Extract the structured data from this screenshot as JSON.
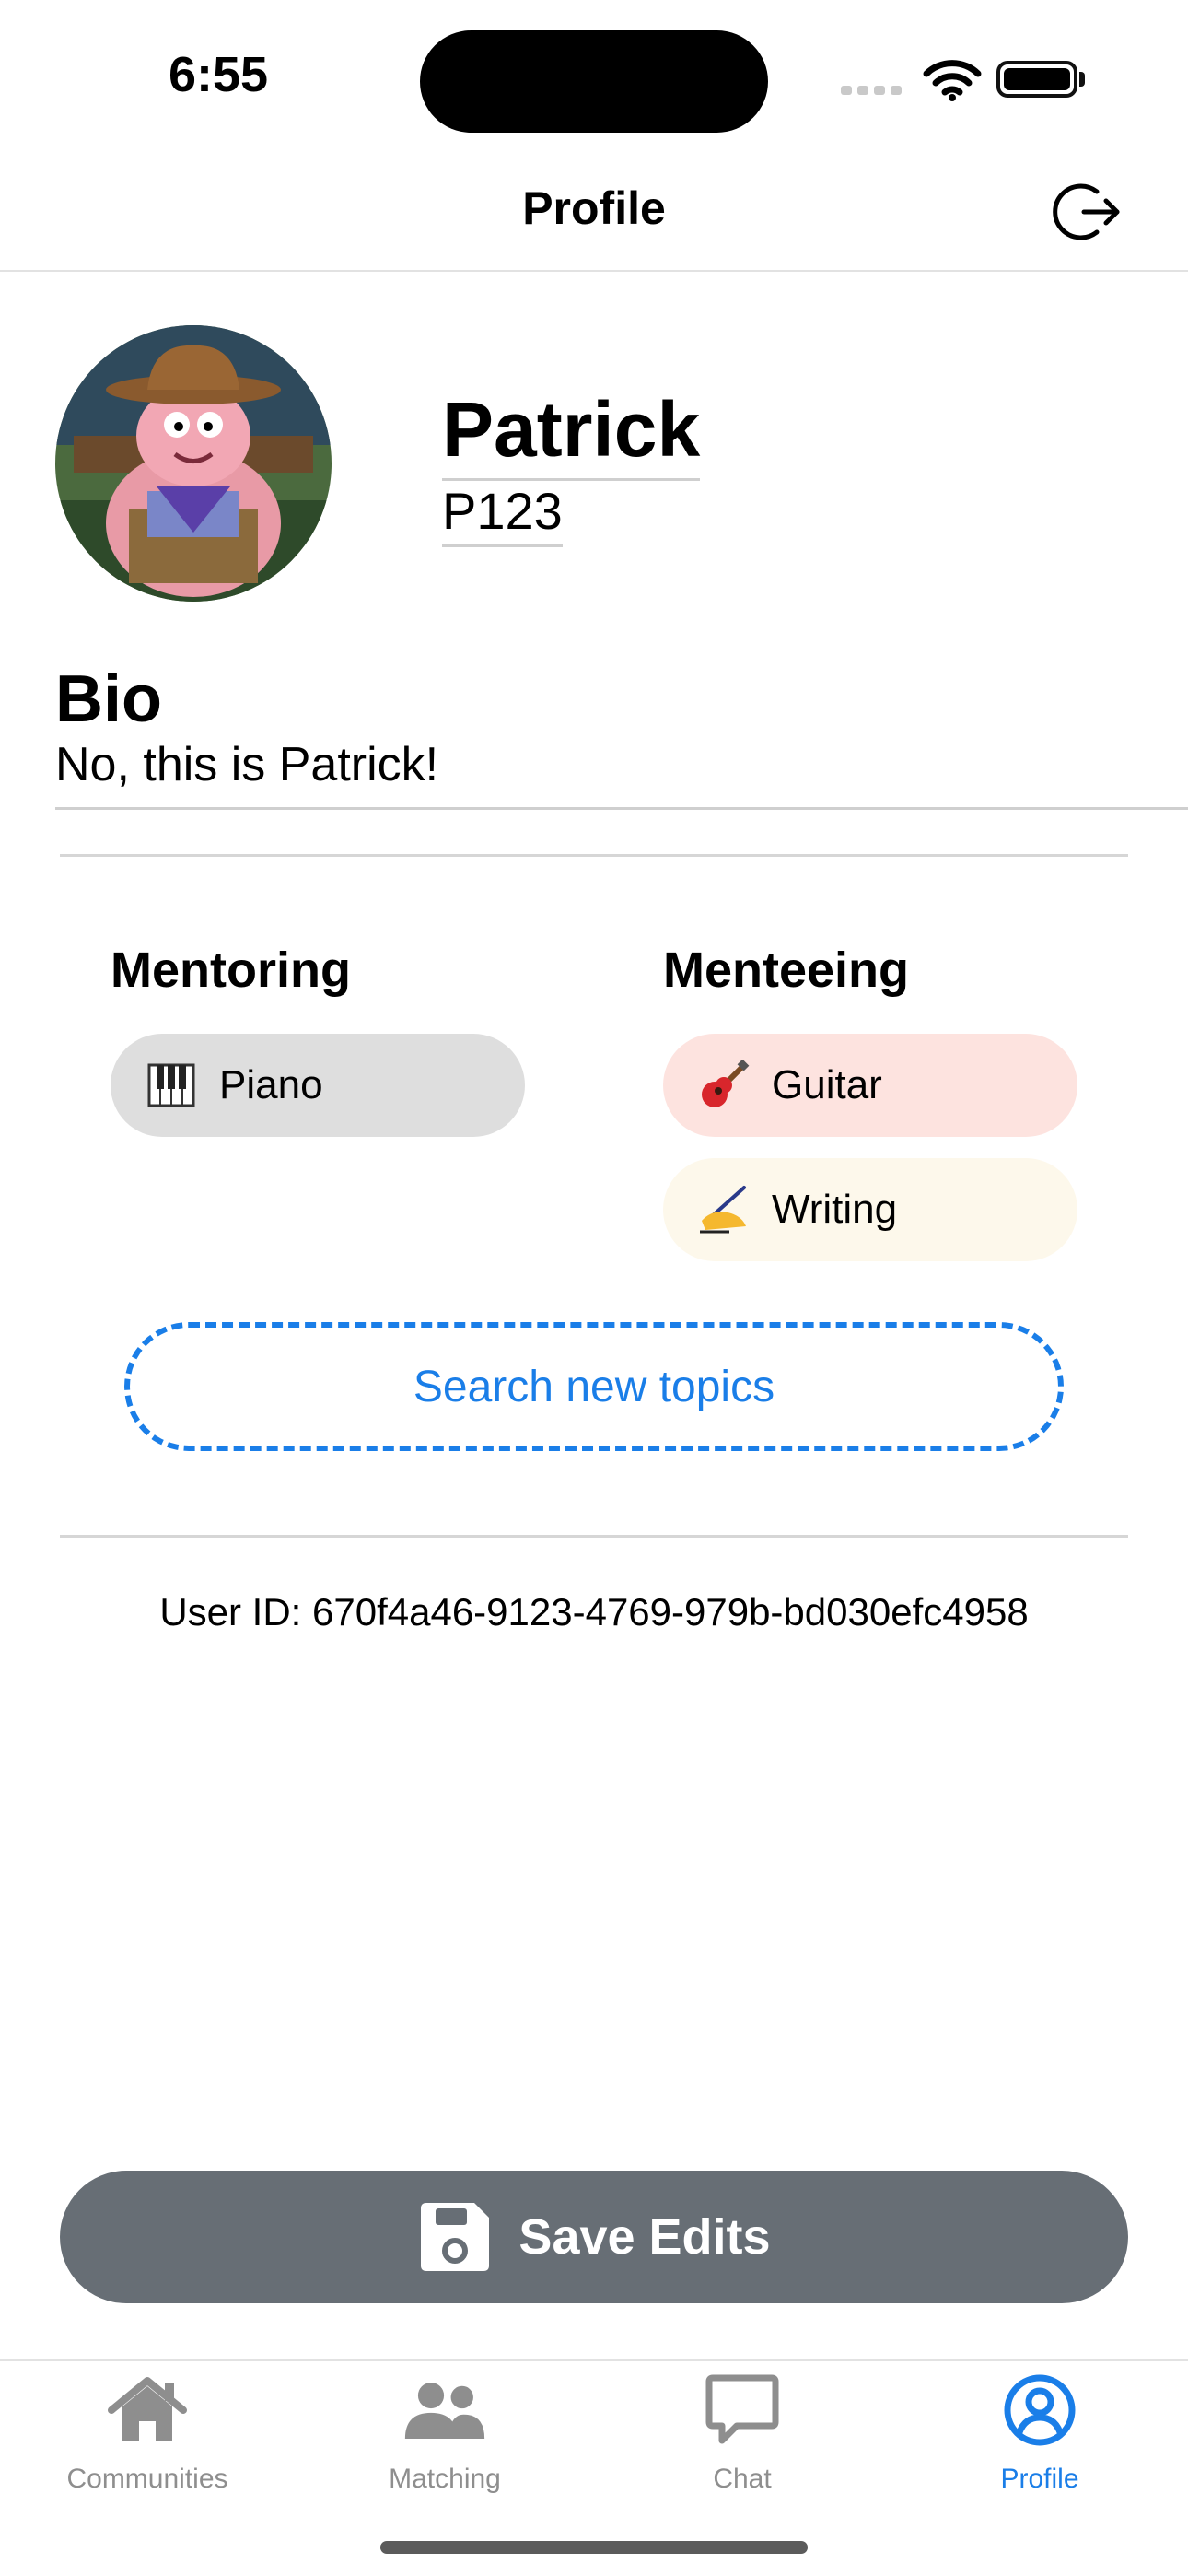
{
  "status_bar": {
    "time": "6:55"
  },
  "nav": {
    "title": "Profile"
  },
  "profile": {
    "name": "Patrick",
    "handle": "P123",
    "bio_title": "Bio",
    "bio": "No, this is Patrick!"
  },
  "topics": {
    "mentoring_title": "Mentoring",
    "menteeing_title": "Menteeing",
    "mentoring": [
      {
        "label": "Piano",
        "emoji": "piano-keys-icon"
      }
    ],
    "menteeing": [
      {
        "label": "Guitar",
        "emoji": "guitar-icon"
      },
      {
        "label": "Writing",
        "emoji": "writing-hand-icon"
      }
    ],
    "search_label": "Search new topics"
  },
  "user_id_text": "User ID: 670f4a46-9123-4769-979b-bd030efc4958",
  "save_label": "Save Edits",
  "tabs": [
    {
      "label": "Communities",
      "active": false
    },
    {
      "label": "Matching",
      "active": false
    },
    {
      "label": "Chat",
      "active": false
    },
    {
      "label": "Profile",
      "active": true
    }
  ],
  "colors": {
    "accent": "#1a7ee8",
    "save_button": "#676e75",
    "pill_mentoring": "#dedede",
    "pill_guitar": "#fde3df",
    "pill_writing": "#fdf8eb"
  }
}
